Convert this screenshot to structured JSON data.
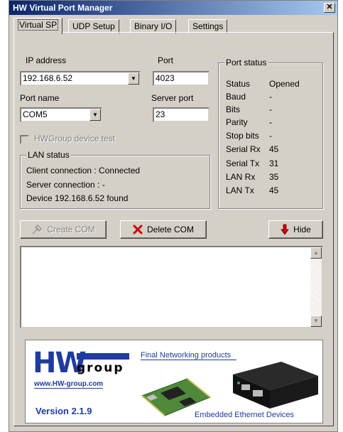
{
  "window": {
    "title": "HW Virtual Port Manager",
    "close_glyph": "✕"
  },
  "tabs": [
    {
      "label": "Virtual SP"
    },
    {
      "label": "UDP Setup"
    },
    {
      "label": "Binary I/O"
    },
    {
      "label": "Settings"
    }
  ],
  "form": {
    "ip_label": "IP address",
    "ip_value": "192.168.6.52",
    "port_label": "Port",
    "port_value": "4023",
    "port_name_label": "Port name",
    "port_name_value": "COM5",
    "server_port_label": "Server port",
    "server_port_value": "23",
    "device_test_label": "HWGroup device test",
    "device_test_checked": false
  },
  "lan_status": {
    "title": "LAN status",
    "lines": [
      "Client connection  : Connected",
      "Server connection : -",
      "Device 192.168.6.52 found"
    ]
  },
  "port_status": {
    "title": "Port status",
    "rows": [
      {
        "label": "Status",
        "value": "Opened"
      },
      {
        "label": "Baud",
        "value": "-"
      },
      {
        "label": "Bits",
        "value": "-"
      },
      {
        "label": "Parity",
        "value": "-"
      },
      {
        "label": "Stop bits",
        "value": "-"
      },
      {
        "label": "Serial Rx",
        "value": "45"
      },
      {
        "label": "Serial Tx",
        "value": "31"
      },
      {
        "label": "LAN Rx",
        "value": "35"
      },
      {
        "label": "LAN Tx",
        "value": "45"
      }
    ]
  },
  "buttons": {
    "create_com": "Create COM",
    "delete_com": "Delete COM",
    "hide": "Hide"
  },
  "banner": {
    "logo_letters": "HW",
    "logo_group": "group",
    "website": "www.HW-group.com",
    "headline": "Final Networking products",
    "version": "Version 2.1.9",
    "tagline": "Embedded Ethernet Devices"
  },
  "colors": {
    "titlebar": "#0a246a",
    "logo_blue": "#1f3b9e",
    "delete_icon": "#d00000",
    "hide_icon": "#d00000"
  }
}
